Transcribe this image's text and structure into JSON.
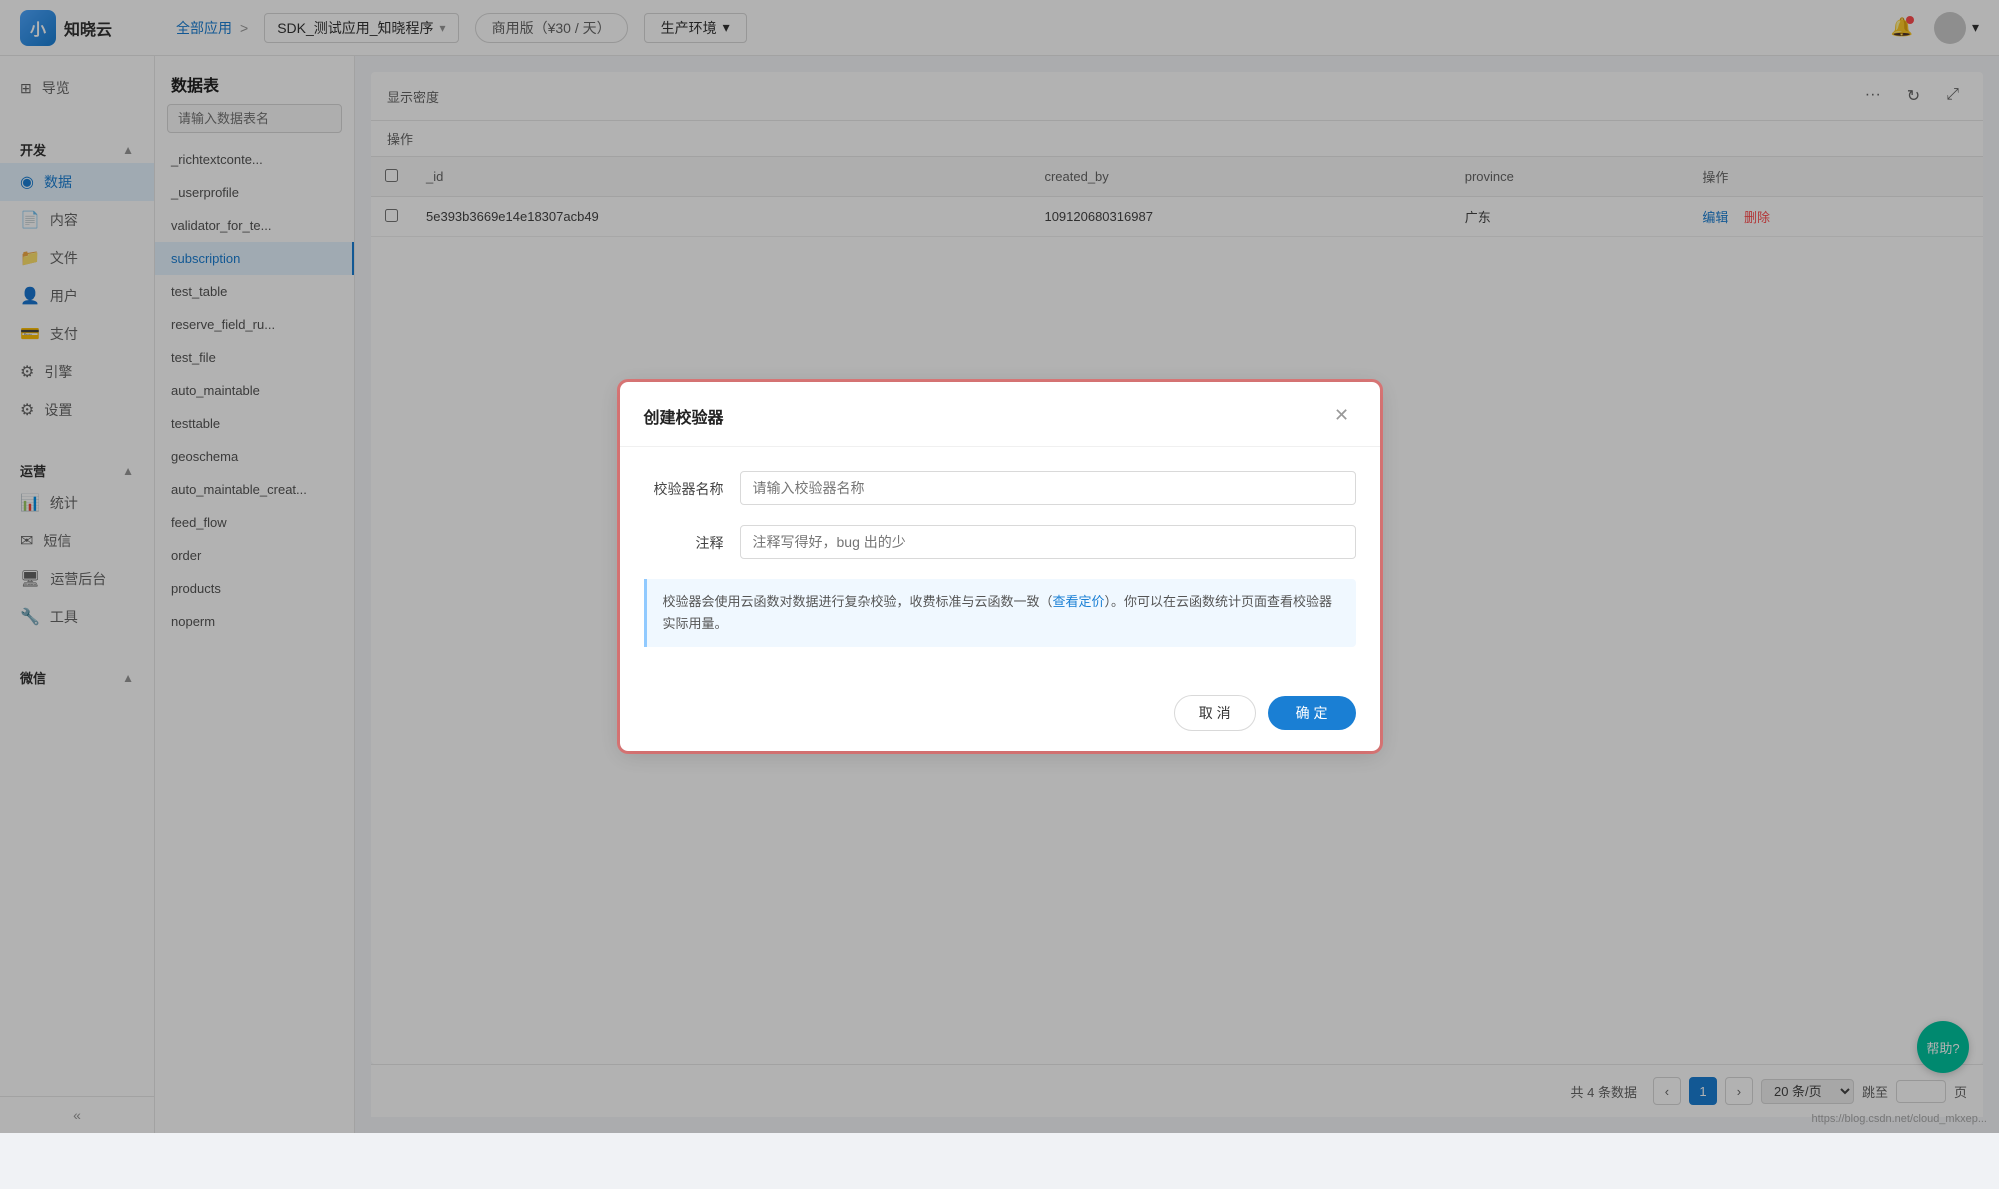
{
  "header": {
    "logo_small": "小",
    "logo_name": "知晓云",
    "breadcrumb_all": "全部应用",
    "breadcrumb_arrow": ">",
    "app_name": "SDK_测试应用_知晓程序",
    "edition": "商用版（¥30 / 天）",
    "env": "生产环境"
  },
  "sidebar": {
    "overview_label": "导览",
    "dev_group": "开发",
    "dev_items": [
      {
        "key": "data",
        "label": "数据",
        "active": true
      },
      {
        "key": "content",
        "label": "内容"
      },
      {
        "key": "file",
        "label": "文件"
      },
      {
        "key": "user",
        "label": "用户"
      },
      {
        "key": "pay",
        "label": "支付"
      },
      {
        "key": "engine",
        "label": "引擎"
      },
      {
        "key": "settings",
        "label": "设置"
      }
    ],
    "ops_group": "运营",
    "ops_items": [
      {
        "key": "stats",
        "label": "统计"
      },
      {
        "key": "sms",
        "label": "短信"
      },
      {
        "key": "ops_admin",
        "label": "运营后台"
      },
      {
        "key": "tools",
        "label": "工具"
      }
    ],
    "wechat_group": "微信",
    "collapse_label": "«"
  },
  "table_list": {
    "header": "数据表",
    "search_placeholder": "请输入数据表名",
    "items": [
      {
        "name": "_richtextconte...",
        "active": false
      },
      {
        "name": "_userprofile",
        "active": false
      },
      {
        "name": "validator_for_te...",
        "active": false
      },
      {
        "name": "subscription",
        "active": true
      },
      {
        "name": "test_table",
        "active": false
      },
      {
        "name": "reserve_field_ru...",
        "active": false
      },
      {
        "name": "test_file",
        "active": false
      },
      {
        "name": "auto_maintable",
        "active": false
      },
      {
        "name": "testtable",
        "active": false
      },
      {
        "name": "geoschema",
        "active": false
      },
      {
        "name": "auto_maintable_creat...",
        "active": false
      },
      {
        "name": "feed_flow",
        "active": false
      },
      {
        "name": "order",
        "active": false
      },
      {
        "name": "products",
        "active": false
      },
      {
        "name": "noperm",
        "active": false
      }
    ]
  },
  "data_area": {
    "display_density_label": "显示密度",
    "operations_label": "操作",
    "table_row": {
      "checkbox": false,
      "id": "5e393b3669e14e18307acb49",
      "field2": "109120680316987",
      "field3": "广东",
      "edit_label": "编辑",
      "delete_label": "删除"
    },
    "pagination": {
      "total_text": "共 4 条数据",
      "page": 1,
      "per_page_label": "20 条/页",
      "jump_label": "跳至",
      "page_label": "页"
    }
  },
  "modal": {
    "title": "创建校验器",
    "name_label": "校验器名称",
    "name_placeholder": "请输入校验器名称",
    "comment_label": "注释",
    "comment_placeholder": "注释写得好，bug 出的少",
    "info_text": "校验器会使用云函数对数据进行复杂校验，收费标准与云函数一致（",
    "info_link": "查看定价",
    "info_text2": "）。你可以在云函数统计页面查看校验器实际用量。",
    "cancel_label": "取 消",
    "confirm_label": "确 定"
  },
  "help_btn": "帮助?",
  "watermark": "https://blog.csdn.net/cloud_mkxep..."
}
